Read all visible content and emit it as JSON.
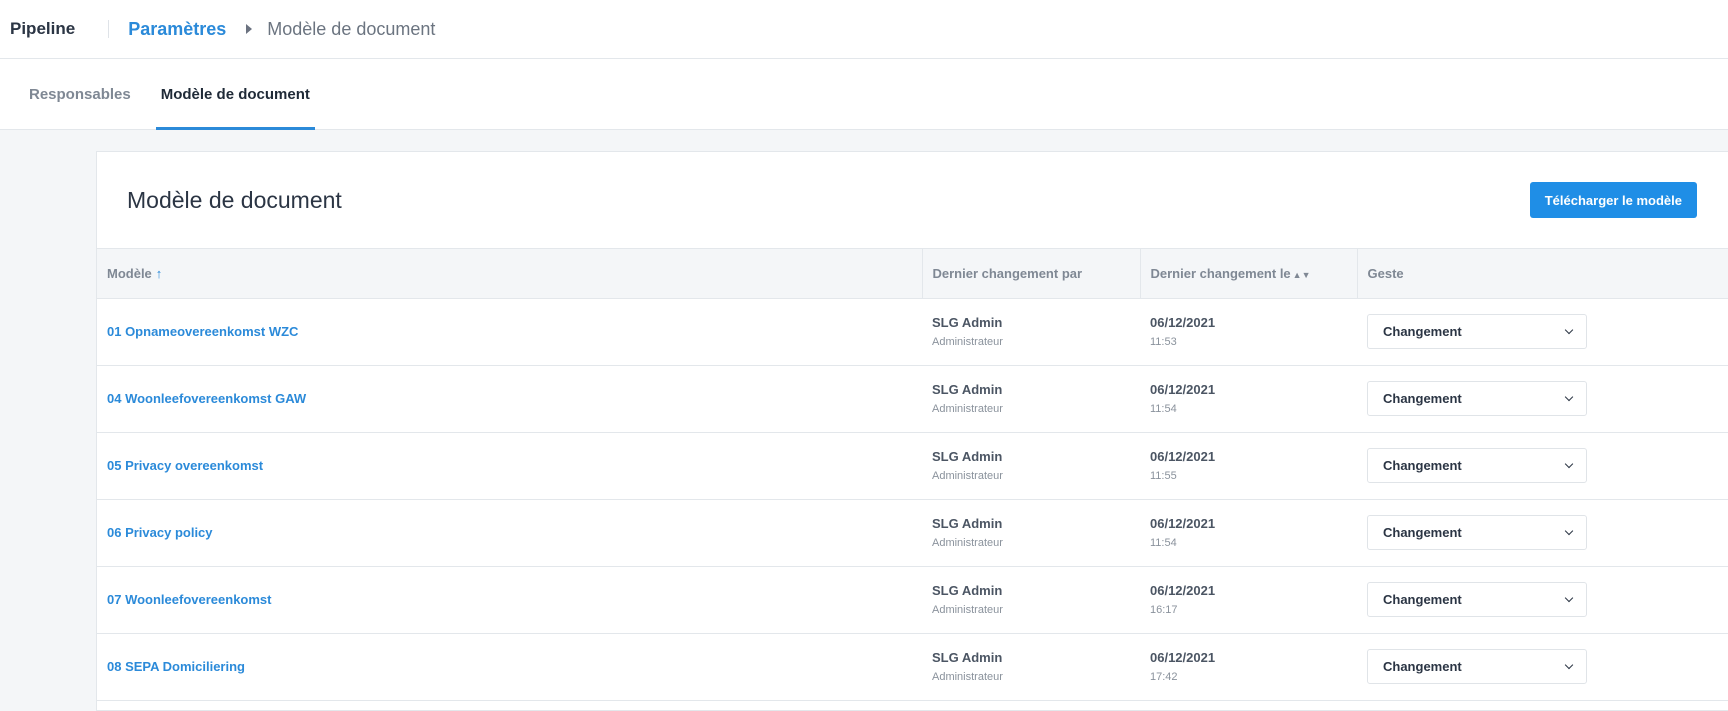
{
  "header": {
    "brand": "Pipeline",
    "breadcrumb": {
      "parent": "Paramètres",
      "current": "Modèle de document"
    }
  },
  "tabs": [
    {
      "label": "Responsables",
      "active": false
    },
    {
      "label": "Modèle de document",
      "active": true
    }
  ],
  "card": {
    "title": "Modèle de document",
    "download_label": "Télécharger le modèle"
  },
  "table": {
    "columns": {
      "model": "Modèle",
      "changed_by": "Dernier changement par",
      "changed_on": "Dernier changement le",
      "action": "Geste"
    },
    "sort_icons": {
      "up": "↑",
      "both": "▲▼"
    },
    "rows": [
      {
        "name": "01 Opnameovereenkomst WZC",
        "user": "SLG Admin",
        "role": "Administrateur",
        "date": "06/12/2021",
        "time": "11:53",
        "action": "Changement"
      },
      {
        "name": "04 Woonleefovereenkomst GAW",
        "user": "SLG Admin",
        "role": "Administrateur",
        "date": "06/12/2021",
        "time": "11:54",
        "action": "Changement"
      },
      {
        "name": "05 Privacy overeenkomst",
        "user": "SLG Admin",
        "role": "Administrateur",
        "date": "06/12/2021",
        "time": "11:55",
        "action": "Changement"
      },
      {
        "name": "06 Privacy policy",
        "user": "SLG Admin",
        "role": "Administrateur",
        "date": "06/12/2021",
        "time": "11:54",
        "action": "Changement"
      },
      {
        "name": "07 Woonleefovereenkomst",
        "user": "SLG Admin",
        "role": "Administrateur",
        "date": "06/12/2021",
        "time": "16:17",
        "action": "Changement"
      },
      {
        "name": "08 SEPA Domiciliering",
        "user": "SLG Admin",
        "role": "Administrateur",
        "date": "06/12/2021",
        "time": "17:42",
        "action": "Changement"
      }
    ]
  }
}
